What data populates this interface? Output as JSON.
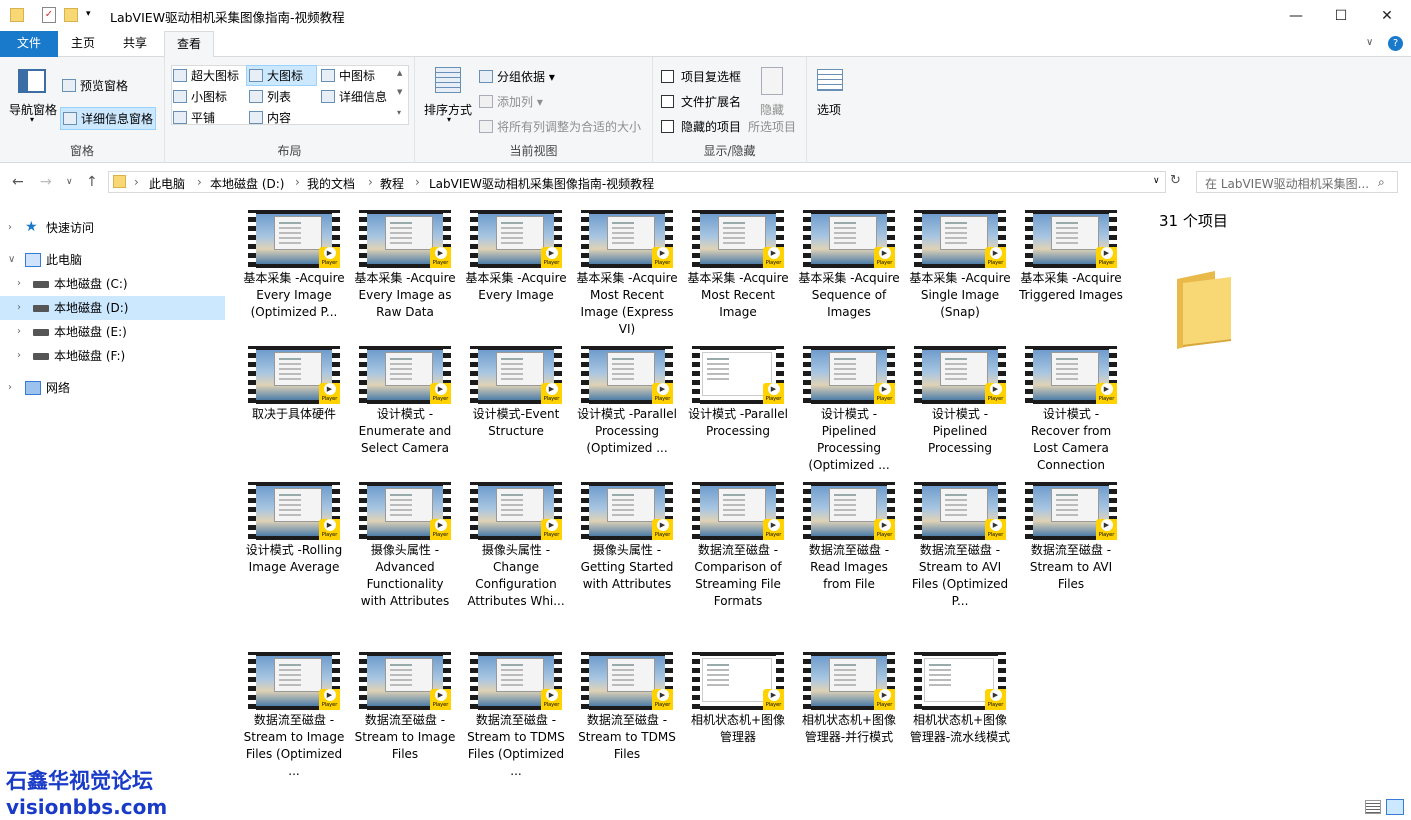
{
  "window": {
    "title": "LabVIEW驱动相机采集图像指南-视频教程",
    "minimize": "—",
    "maximize": "☐",
    "close": "✕"
  },
  "ribbon_tabs": [
    "文件",
    "主页",
    "共享",
    "查看"
  ],
  "ribbon": {
    "panes": {
      "nav_pane": "导航窗格",
      "preview_pane": "预览窗格",
      "details_pane": "详细信息窗格",
      "label": "窗格"
    },
    "layout": {
      "extra_large": "超大图标",
      "large": "大图标",
      "medium": "中图标",
      "small": "小图标",
      "list": "列表",
      "details": "详细信息",
      "tiles": "平铺",
      "content": "内容",
      "label": "布局"
    },
    "current_view": {
      "sort_by": "排序方式",
      "group_by": "分组依据",
      "add_columns": "添加列",
      "size_all_columns": "将所有列调整为合适的大小",
      "label": "当前视图"
    },
    "show_hide": {
      "item_checkboxes": "项目复选框",
      "file_extensions": "文件扩展名",
      "hidden_items": "隐藏的项目",
      "hide_selected_1": "隐藏",
      "hide_selected_2": "所选项目",
      "label": "显示/隐藏"
    },
    "options": "选项"
  },
  "address": {
    "breadcrumbs": [
      "此电脑",
      "本地磁盘 (D:)",
      "我的文档",
      "教程",
      "LabVIEW驱动相机采集图像指南-视频教程"
    ],
    "search_placeholder": "在 LabVIEW驱动相机采集图..."
  },
  "sidebar": [
    {
      "label": "快速访问",
      "icon": "star-icon"
    },
    {
      "label": "此电脑",
      "icon": "computer-icon"
    },
    {
      "label": "本地磁盘 (C:)",
      "icon": "drive-icon"
    },
    {
      "label": "本地磁盘 (D:)",
      "icon": "drive-icon"
    },
    {
      "label": "本地磁盘 (E:)",
      "icon": "drive-icon"
    },
    {
      "label": "本地磁盘 (F:)",
      "icon": "drive-icon"
    },
    {
      "label": "网络",
      "icon": "network-icon"
    }
  ],
  "player_badge": "Player",
  "files": [
    "基本采集 -Acquire Every Image (Optimized P...",
    "基本采集 -Acquire Every Image as Raw Data",
    "基本采集 -Acquire Every Image",
    "基本采集 -Acquire Most Recent Image (Express VI)",
    "基本采集 -Acquire Most Recent Image",
    "基本采集 -Acquire Sequence of Images",
    "基本采集 -Acquire Single Image (Snap)",
    "基本采集 -Acquire Triggered Images",
    "取决于具体硬件",
    "设计模式 -Enumerate and Select Camera",
    "设计模式-Event Structure",
    "设计模式 -Parallel Processing (Optimized ...",
    "设计模式 -Parallel Processing",
    "设计模式 -Pipelined Processing (Optimized ...",
    "设计模式 -Pipelined Processing",
    "设计模式 -Recover from Lost Camera Connection",
    "设计模式 -Rolling Image Average",
    "摄像头属性 -Advanced Functionality with Attributes",
    "摄像头属性 -Change Configuration Attributes Whi...",
    "摄像头属性 -Getting Started with Attributes",
    "数据流至磁盘 -Comparison of Streaming File Formats",
    "数据流至磁盘 -Read Images from File",
    "数据流至磁盘 -Stream to AVI Files (Optimized P...",
    "数据流至磁盘 -Stream to AVI Files",
    "数据流至磁盘 -Stream to Image Files (Optimized ...",
    "数据流至磁盘 -Stream to Image Files",
    "数据流至磁盘 -Stream to TDMS Files (Optimized ...",
    "数据流至磁盘 -Stream to TDMS Files",
    "相机状态机+图像管理器",
    "相机状态机+图像管理器-并行模式",
    "相机状态机+图像管理器-流水线模式"
  ],
  "details": {
    "count": "31 个项目"
  },
  "watermark": {
    "line1": "石鑫华视觉论坛",
    "line2": "visionbbs.com"
  }
}
